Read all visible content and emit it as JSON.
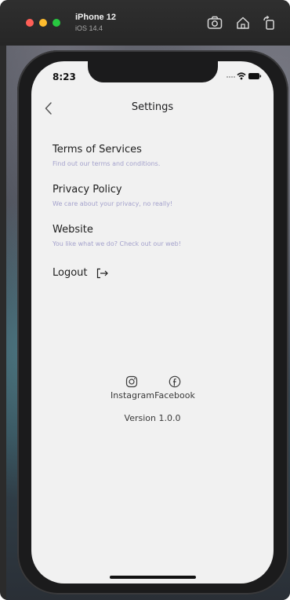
{
  "simulator": {
    "device_name": "iPhone 12",
    "os_version": "iOS 14.4",
    "icons": [
      "screenshot-icon",
      "home-icon",
      "rotate-icon"
    ]
  },
  "status_bar": {
    "time": "8:23",
    "icons": [
      "signal-dots-icon",
      "wifi-icon",
      "battery-icon"
    ]
  },
  "nav": {
    "back_icon": "chevron-left-icon",
    "title": "Settings"
  },
  "menu": {
    "items": [
      {
        "title": "Terms of Services",
        "subtitle": "Find out our terms and conditions."
      },
      {
        "title": "Privacy Policy",
        "subtitle": "We care about your privacy, no really!"
      },
      {
        "title": "Website",
        "subtitle": "You like what we do? Check out our web!"
      }
    ],
    "logout_label": "Logout",
    "logout_icon": "logout-icon"
  },
  "social": {
    "instagram_label": "Instagram",
    "facebook_label": "Facebook"
  },
  "footer": {
    "version": "Version 1.0.0"
  },
  "colors": {
    "screen_background": "#f1f1f1",
    "subtitle_text": "#a4a2cc",
    "primary_text": "#1e1e1e"
  }
}
